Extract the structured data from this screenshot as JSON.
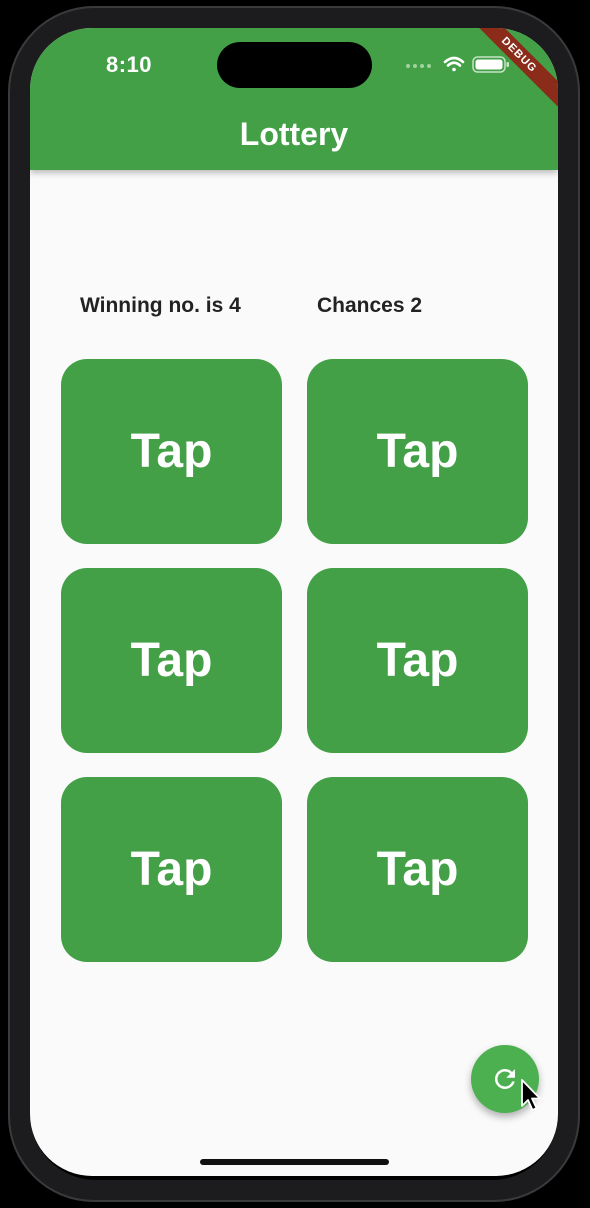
{
  "status_bar": {
    "time": "8:10",
    "signal_icon": "cellular-signal-icon",
    "wifi_icon": "wifi-icon",
    "battery_icon": "battery-icon"
  },
  "debug_banner": "DEBUG",
  "app_bar": {
    "title": "Lottery",
    "color": "#43a047"
  },
  "info": {
    "winning_text": "Winning no. is 4",
    "chances_text": "Chances 2"
  },
  "tiles": [
    {
      "label": "Tap"
    },
    {
      "label": "Tap"
    },
    {
      "label": "Tap"
    },
    {
      "label": "Tap"
    },
    {
      "label": "Tap"
    },
    {
      "label": "Tap"
    }
  ],
  "fab": {
    "icon": "refresh-icon",
    "color": "#4caf50"
  },
  "colors": {
    "tile": "#43a047",
    "background": "#fafafa",
    "text_dark": "#222222"
  }
}
